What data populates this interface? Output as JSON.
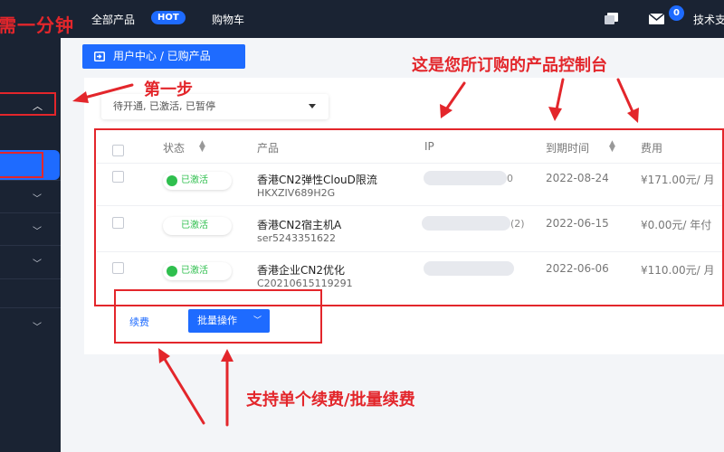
{
  "top_bar": {
    "brand_text": "需一分钟",
    "nav_all_products": "全部产品",
    "hot_badge": "HOT",
    "nav_cart": "购物车",
    "mail_badge_count": "0",
    "support_text": "技术支"
  },
  "user_center_button": "用户中心 / 已购产品",
  "filter_select": "待开通, 已激活, 已暂停",
  "table": {
    "headers": {
      "status": "状态",
      "product": "产品",
      "ip": "IP",
      "expiry": "到期时间",
      "fee": "费用"
    },
    "rows": [
      {
        "status": "已激活",
        "status_dot": true,
        "product_name": "香港CN2弹性ClouD限流",
        "product_code": "HKXZIV689H2G",
        "ip_suffix": "0",
        "expiry": "2022-08-24",
        "fee": "¥171.00元/ 月"
      },
      {
        "status": "已激活",
        "status_dot": false,
        "product_name": "香港CN2宿主机A",
        "product_code": "ser5243351622",
        "ip_suffix": "(2)",
        "expiry": "2022-06-15",
        "fee": "¥0.00元/ 年付"
      },
      {
        "status": "已激活",
        "status_dot": true,
        "product_name": "香港企业CN2优化",
        "product_code": "C20210615119291",
        "ip_suffix": "",
        "expiry": "2022-06-06",
        "fee": "¥110.00元/ 月"
      }
    ]
  },
  "actions": {
    "renew": "续费",
    "batch": "批量操作"
  },
  "annotations": {
    "step_one": "第一步",
    "console": "这是您所订购的产品控制台",
    "renew_support": "支持单个续费/批量续费"
  },
  "colors": {
    "topbar_bg": "#1a2333",
    "accent_blue": "#1e6bff",
    "annotation_red": "#e3262b",
    "status_green": "#2fbf4e"
  }
}
